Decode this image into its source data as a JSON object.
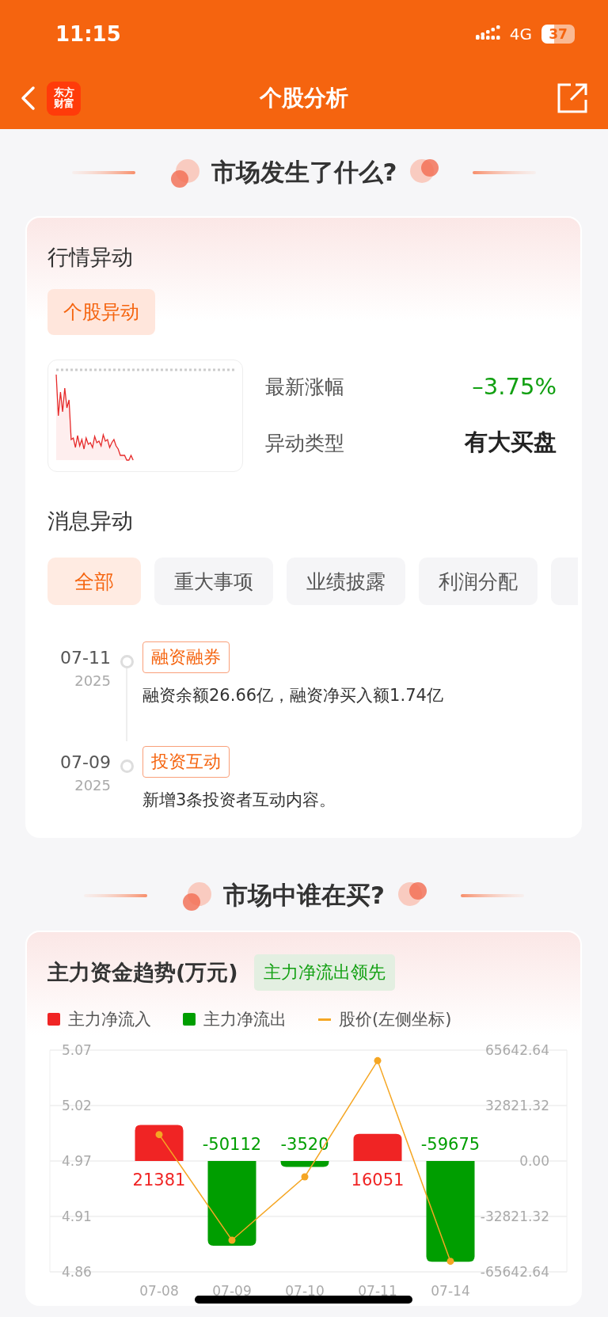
{
  "status_bar": {
    "time": "11:15",
    "network": "4G",
    "battery": "37"
  },
  "nav": {
    "logo": [
      "东方",
      "财富"
    ],
    "title": "个股分析"
  },
  "section_1": {
    "heading": "市场发生了什么?"
  },
  "market_card": {
    "title": "行情异动",
    "chip": "个股异动",
    "stats": [
      {
        "label": "最新涨幅",
        "value": "–3.75%",
        "kind": "change"
      },
      {
        "label": "异动类型",
        "value": "有大买盘",
        "kind": "text"
      }
    ]
  },
  "news": {
    "title": "消息异动",
    "tabs": [
      {
        "label": "全部",
        "selected": true
      },
      {
        "label": "重大事项",
        "selected": false
      },
      {
        "label": "业绩披露",
        "selected": false
      },
      {
        "label": "利润分配",
        "selected": false
      }
    ],
    "events": [
      {
        "date": "07-11",
        "year": "2025",
        "tag": "融资融券",
        "text": "融资余额26.66亿，融资净买入额1.74亿"
      },
      {
        "date": "07-09",
        "year": "2025",
        "tag": "投资互动",
        "text": "新增3条投资者互动内容。"
      }
    ]
  },
  "section_2": {
    "heading": "市场中谁在买?"
  },
  "fund_card": {
    "title": "主力资金趋势(万元)",
    "badge": "主力净流出领先",
    "chart_data": {
      "type": "bar",
      "categories": [
        "07-08",
        "07-09",
        "07-10",
        "07-11",
        "07-14"
      ],
      "series": [
        {
          "name": "主力净流入",
          "color": "#f02424",
          "values": [
            21381,
            null,
            null,
            16051,
            null
          ]
        },
        {
          "name": "主力净流出",
          "color": "#009e00",
          "values": [
            null,
            -50112,
            -3520,
            null,
            -59675
          ]
        }
      ],
      "ylim": [
        -65642.64,
        65642.64
      ],
      "yticks": [
        {
          "value": 65642.64,
          "label": "65642.64"
        },
        {
          "value": 32821.32,
          "label": "32821.32"
        },
        {
          "value": 0,
          "label": "0.00"
        },
        {
          "value": -32821.32,
          "label": "-32821.32"
        },
        {
          "value": -65642.64,
          "label": "-65642.64"
        }
      ],
      "grid": true,
      "data_labels": true
    },
    "price_chart": {
      "chart_data": {
        "type": "line",
        "series": [
          {
            "name": "股价(左侧坐标)",
            "color": "#f5a623",
            "marker": true,
            "values": [
              4.99,
              4.89,
              4.95,
              5.06,
              4.87
            ]
          }
        ],
        "ylim": [
          4.86,
          5.07
        ],
        "yticks": [
          {
            "value": 5.07,
            "label": "5.07"
          },
          {
            "value": 5.0175,
            "label": "5.02"
          },
          {
            "value": 4.965,
            "label": "4.97"
          },
          {
            "value": 4.9125,
            "label": "4.91"
          },
          {
            "value": 4.86,
            "label": "4.86"
          }
        ]
      }
    }
  }
}
